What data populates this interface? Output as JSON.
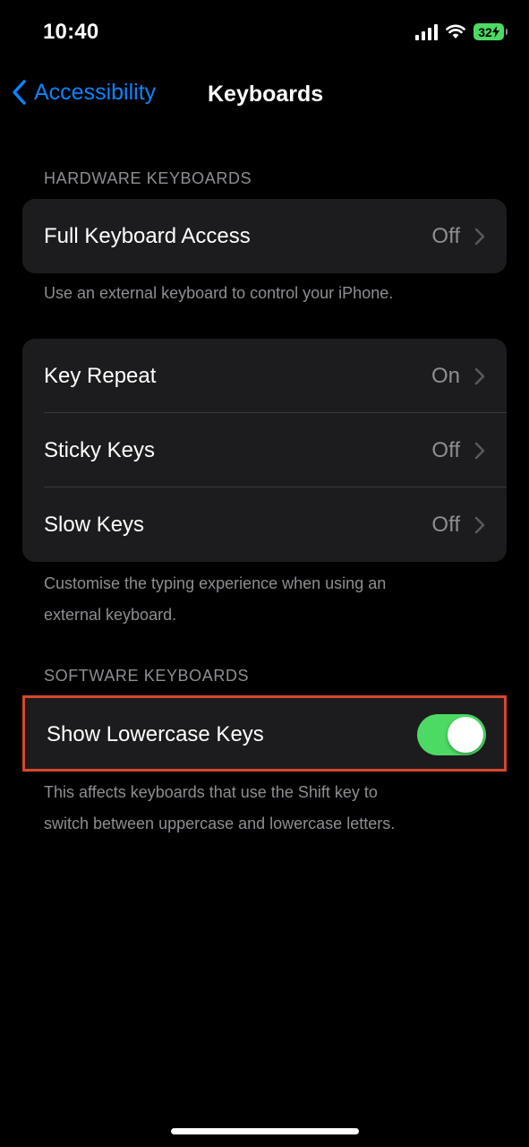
{
  "status_bar": {
    "time": "10:40",
    "battery": "32"
  },
  "nav": {
    "back_label": "Accessibility",
    "title": "Keyboards"
  },
  "hardware_section": {
    "header": "HARDWARE KEYBOARDS",
    "full_keyboard_access": {
      "label": "Full Keyboard Access",
      "value": "Off"
    },
    "full_keyboard_footer": "Use an external keyboard to control your iPhone.",
    "rows": [
      {
        "label": "Key Repeat",
        "value": "On"
      },
      {
        "label": "Sticky Keys",
        "value": "Off"
      },
      {
        "label": "Slow Keys",
        "value": "Off"
      }
    ],
    "rows_footer_line1": "Customise the typing experience when using an",
    "rows_footer_line2": "external keyboard."
  },
  "software_section": {
    "header": "SOFTWARE KEYBOARDS",
    "show_lowercase": {
      "label": "Show Lowercase Keys",
      "enabled": true
    },
    "footer_line1": "This affects keyboards that use the Shift key to",
    "footer_line2": "switch between uppercase and lowercase letters."
  },
  "colors": {
    "accent": "#0a84ff",
    "toggle_on": "#4cd964",
    "highlight": "#d9472b",
    "cell_bg": "#1c1c1e",
    "secondary_text": "#8e8e93"
  }
}
